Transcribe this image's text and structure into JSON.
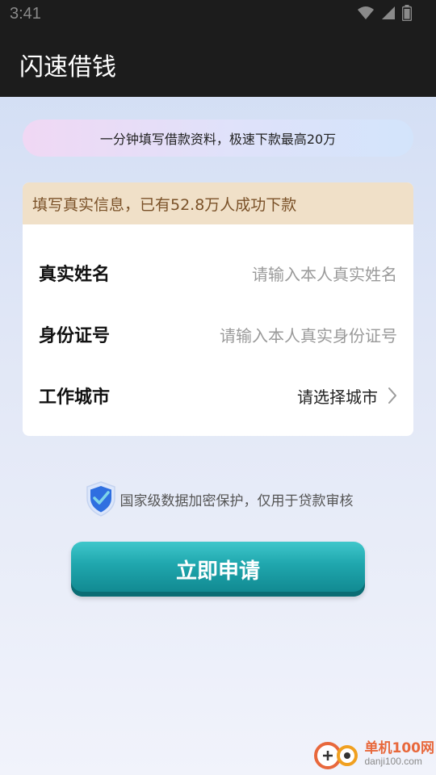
{
  "status_bar": {
    "time": "3:41"
  },
  "app_bar": {
    "title": "闪速借钱"
  },
  "banner": {
    "text": "一分钟填写借款资料，极速下款最高20万"
  },
  "form_card": {
    "header": "填写真实信息，已有52.8万人成功下款",
    "fields": [
      {
        "label": "真实姓名",
        "placeholder": "请输入本人真实姓名"
      },
      {
        "label": "身份证号",
        "placeholder": "请输入本人真实身份证号"
      },
      {
        "label": "工作城市",
        "value": "请选择城市"
      }
    ]
  },
  "security_notice": {
    "text": "国家级数据加密保护，仅用于贷款审核"
  },
  "submit_button": {
    "label": "立即申请"
  },
  "watermark": {
    "brand": "单机100网",
    "url": "danji100.com"
  },
  "colors": {
    "header_bg": "#1c1c1c",
    "card_header_bg": "#f0e0c8",
    "card_header_text": "#7a5128",
    "button_teal": "#20a7ae",
    "watermark_orange": "#e8683c"
  }
}
